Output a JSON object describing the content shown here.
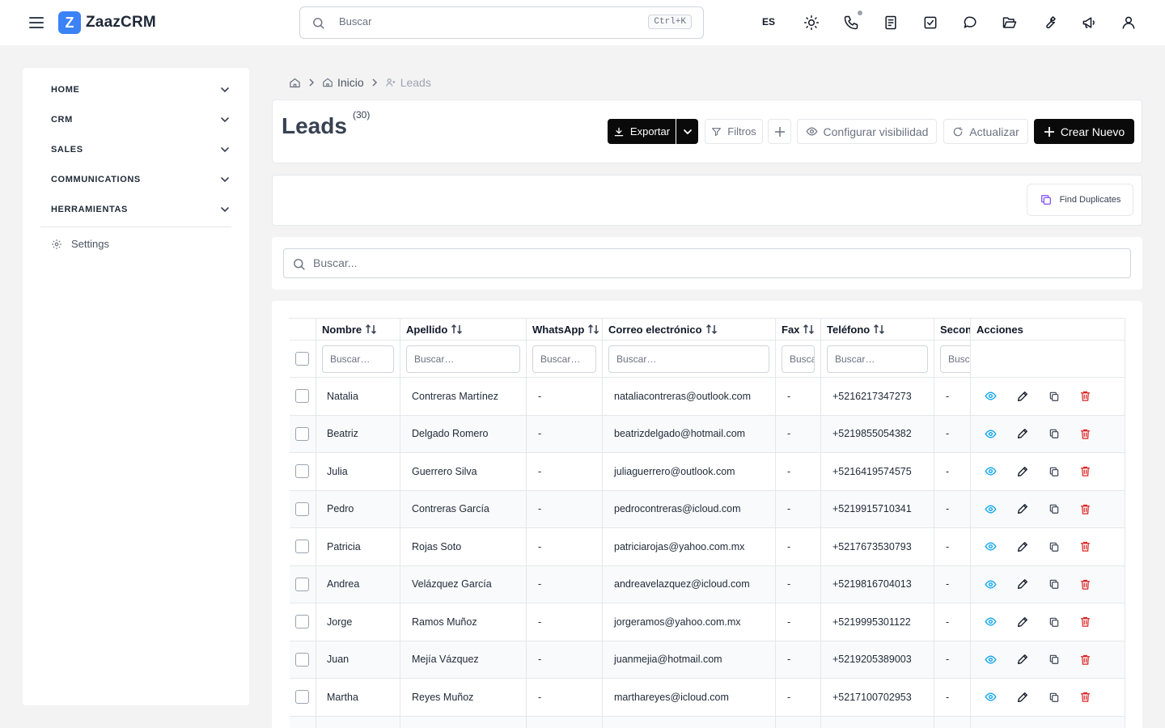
{
  "app": {
    "name": "ZaazCRM",
    "logo_letter": "Z"
  },
  "topbar": {
    "search_placeholder": "Buscar",
    "shortcut": "Ctrl+K",
    "language": "ES",
    "icons": [
      "sun-icon",
      "phone-icon",
      "notes-icon",
      "tasks-icon",
      "chat-icon",
      "folder-icon",
      "wrench-icon",
      "megaphone-icon",
      "user-icon"
    ]
  },
  "sidebar": {
    "items": [
      {
        "label": "HOME"
      },
      {
        "label": "CRM"
      },
      {
        "label": "SALES"
      },
      {
        "label": "COMMUNICATIONS"
      },
      {
        "label": "HERRAMIENTAS"
      }
    ],
    "settings": "Settings"
  },
  "breadcrumb": {
    "home": "Inicio",
    "current": "Leads"
  },
  "page": {
    "title": "Leads",
    "count": "(30)",
    "buttons": {
      "export": "Exportar",
      "filters": "Filtros",
      "visibility": "Configurar visibilidad",
      "refresh": "Actualizar",
      "create": "Crear Nuevo",
      "duplicates": "Find Duplicates"
    },
    "search_placeholder": "Buscar..."
  },
  "table": {
    "columns": [
      "Nombre",
      "Apellido",
      "WhatsApp",
      "Correo electrónico",
      "Fax",
      "Teléfono",
      "Secon",
      "Acciones"
    ],
    "filter_placeholder": "Buscar…",
    "rows": [
      {
        "nombre": "Natalia",
        "apellido": "Contreras Martínez",
        "whatsapp": "-",
        "correo": "nataliacontreras@outlook.com",
        "fax": "-",
        "telefono": "+5216217347273",
        "second": "-"
      },
      {
        "nombre": "Beatriz",
        "apellido": "Delgado Romero",
        "whatsapp": "-",
        "correo": "beatrizdelgado@hotmail.com",
        "fax": "-",
        "telefono": "+5219855054382",
        "second": "-"
      },
      {
        "nombre": "Julia",
        "apellido": "Guerrero Silva",
        "whatsapp": "-",
        "correo": "juliaguerrero@outlook.com",
        "fax": "-",
        "telefono": "+5216419574575",
        "second": "-"
      },
      {
        "nombre": "Pedro",
        "apellido": "Contreras García",
        "whatsapp": "-",
        "correo": "pedrocontreras@icloud.com",
        "fax": "-",
        "telefono": "+5219915710341",
        "second": "-"
      },
      {
        "nombre": "Patricia",
        "apellido": "Rojas Soto",
        "whatsapp": "-",
        "correo": "patriciarojas@yahoo.com.mx",
        "fax": "-",
        "telefono": "+5217673530793",
        "second": "-"
      },
      {
        "nombre": "Andrea",
        "apellido": "Velázquez García",
        "whatsapp": "-",
        "correo": "andreavelazquez@icloud.com",
        "fax": "-",
        "telefono": "+5219816704013",
        "second": "-"
      },
      {
        "nombre": "Jorge",
        "apellido": "Ramos Muñoz",
        "whatsapp": "-",
        "correo": "jorgeramos@yahoo.com.mx",
        "fax": "-",
        "telefono": "+5219995301122",
        "second": "-"
      },
      {
        "nombre": "Juan",
        "apellido": "Mejía Vázquez",
        "whatsapp": "-",
        "correo": "juanmejia@hotmail.com",
        "fax": "-",
        "telefono": "+5219205389003",
        "second": "-"
      },
      {
        "nombre": "Martha",
        "apellido": "Reyes Muñoz",
        "whatsapp": "-",
        "correo": "marthareyes@icloud.com",
        "fax": "-",
        "telefono": "+5217100702953",
        "second": "-"
      },
      {
        "nombre": "",
        "apellido": "",
        "whatsapp": "",
        "correo": "",
        "fax": "",
        "telefono": "",
        "second": ""
      }
    ]
  },
  "colors": {
    "accent": "#3b82f6",
    "primary_button": "#0a0a0a",
    "view_icon": "#0ea5e9",
    "delete_icon": "#dc2626",
    "duplicates_icon": "#8b5cf6"
  }
}
